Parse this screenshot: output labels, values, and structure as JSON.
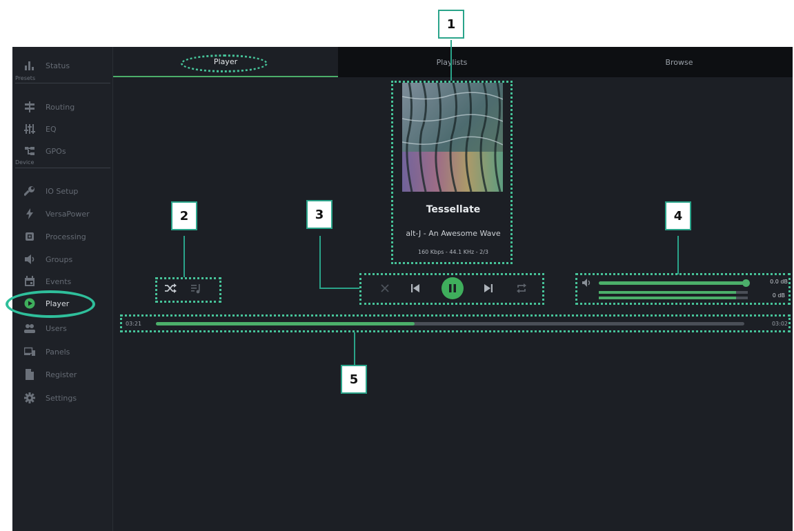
{
  "sidebar": {
    "sections": [
      "Presets",
      "Device"
    ],
    "items": [
      {
        "label": "Status",
        "icon": "bar-chart-icon"
      },
      {
        "label": "Routing",
        "icon": "routing-icon"
      },
      {
        "label": "EQ",
        "icon": "eq-sliders-icon"
      },
      {
        "label": "GPOs",
        "icon": "gpo-icon"
      },
      {
        "label": "IO Setup",
        "icon": "wrench-icon"
      },
      {
        "label": "VersaPower",
        "icon": "lightning-icon"
      },
      {
        "label": "Processing",
        "icon": "chip-icon"
      },
      {
        "label": "Groups",
        "icon": "speaker-icon"
      },
      {
        "label": "Events",
        "icon": "calendar-icon"
      },
      {
        "label": "Player",
        "icon": "play-circle-icon"
      },
      {
        "label": "Users",
        "icon": "users-icon"
      },
      {
        "label": "Panels",
        "icon": "panels-icon"
      },
      {
        "label": "Register",
        "icon": "document-icon"
      },
      {
        "label": "Settings",
        "icon": "gear-icon"
      }
    ]
  },
  "tabs": [
    "Player",
    "Playlists",
    "Browse"
  ],
  "track": {
    "title": "Tessellate",
    "subtitle": "alt-J - An Awesome Wave",
    "meta": "160 Kbps - 44.1 KHz - 2/3"
  },
  "volume": {
    "main_db": "0.0 dB",
    "second_db": "0 dB",
    "main_level": 1.0,
    "left_level": 0.92,
    "right_level": 0.92
  },
  "progress": {
    "elapsed": "03:21",
    "total": "03:02",
    "fraction": 0.44
  },
  "callouts": [
    "1",
    "2",
    "3",
    "4",
    "5"
  ],
  "colors": {
    "accent": "#4caf6a",
    "annotation": "#47c49a",
    "background": "#1c1f25"
  }
}
